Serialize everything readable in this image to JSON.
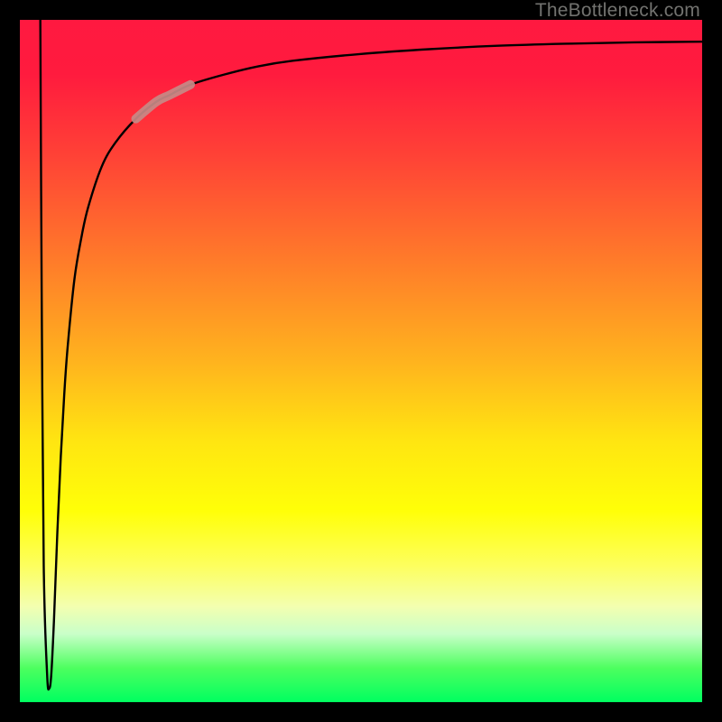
{
  "watermark": "TheBottleneck.com",
  "colors": {
    "frame": "#000000",
    "gradient_top": "#ff1940",
    "gradient_mid": "#ffff08",
    "gradient_bottom": "#00ff60",
    "curve": "#000000",
    "highlight": "#c78a87"
  },
  "chart_data": {
    "type": "line",
    "title": "",
    "xlabel": "",
    "ylabel": "",
    "xlim": [
      0,
      100
    ],
    "ylim": [
      0,
      100
    ],
    "grid": false,
    "legend": false,
    "series": [
      {
        "name": "curve",
        "x": [
          3.0,
          3.2,
          3.5,
          4.0,
          4.3,
          4.6,
          5.0,
          5.5,
          6.0,
          6.5,
          7.0,
          8.0,
          9.0,
          10.0,
          12.0,
          14.0,
          17.0,
          20.0,
          22.0,
          25.0,
          30.0,
          35.0,
          40.0,
          50.0,
          60.0,
          70.0,
          80.0,
          90.0,
          100.0
        ],
        "y": [
          100.0,
          60.0,
          20.0,
          4.0,
          2.0,
          4.0,
          12.0,
          25.0,
          36.0,
          45.0,
          52.0,
          62.0,
          68.0,
          72.5,
          78.5,
          82.0,
          85.5,
          88.0,
          89.0,
          90.5,
          92.0,
          93.2,
          94.0,
          95.0,
          95.7,
          96.2,
          96.5,
          96.7,
          96.8
        ]
      }
    ],
    "highlight_segment": {
      "x_start": 17.0,
      "x_end": 25.0
    }
  }
}
